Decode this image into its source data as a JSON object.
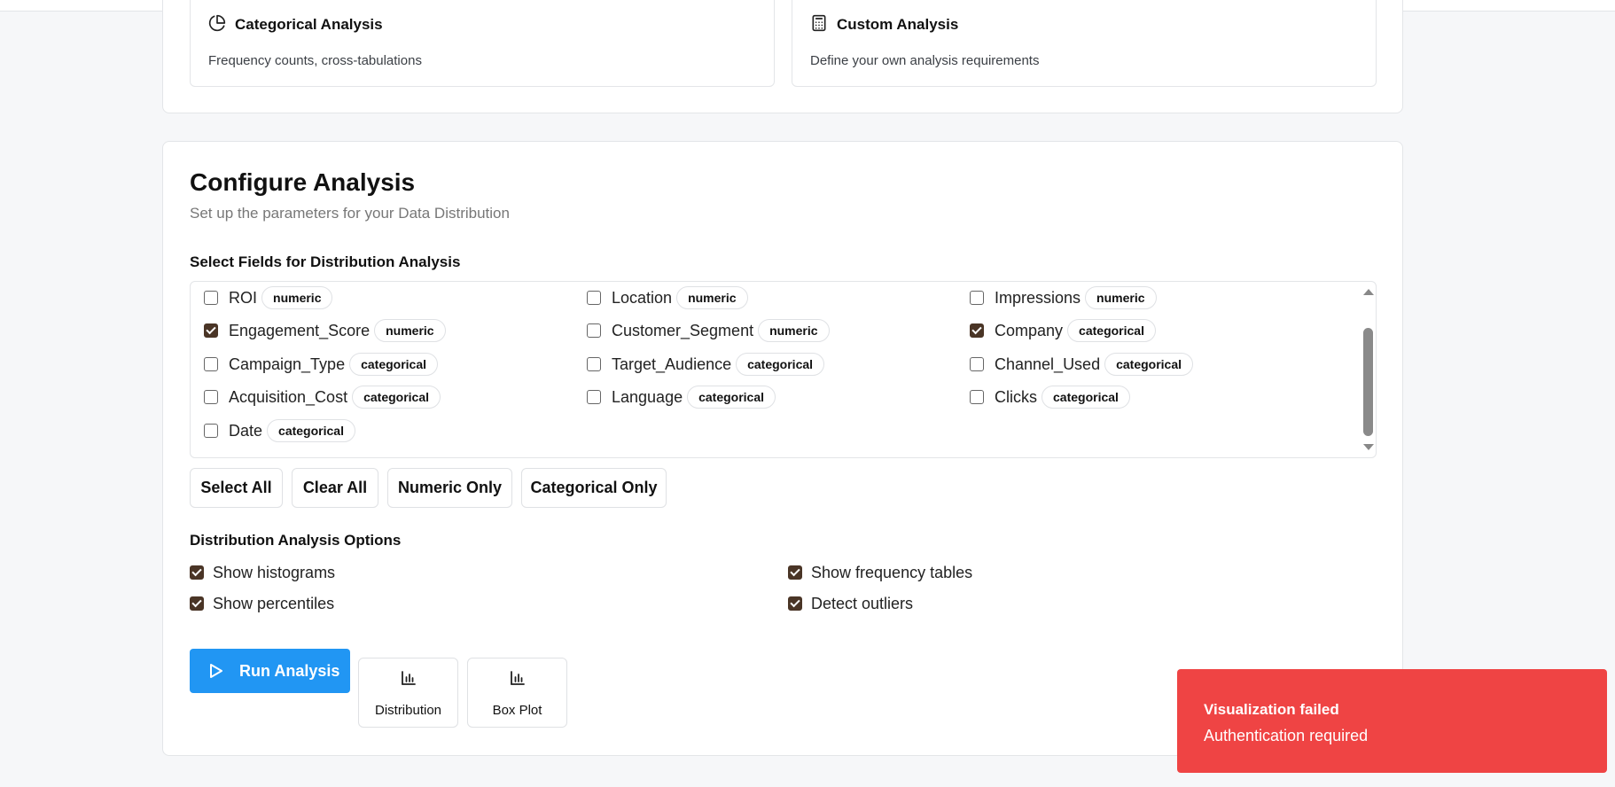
{
  "analysis_types": [
    {
      "title": "Categorical Analysis",
      "description": "Frequency counts, cross-tabulations",
      "icon": "pie-chart-icon"
    },
    {
      "title": "Custom Analysis",
      "description": "Define your own analysis requirements",
      "icon": "calculator-icon"
    }
  ],
  "configure": {
    "title": "Configure Analysis",
    "subtitle": "Set up the parameters for your Data Distribution",
    "fields_label": "Select Fields for Distribution Analysis",
    "fields": [
      {
        "name": "ROI",
        "type": "numeric",
        "checked": false
      },
      {
        "name": "Location",
        "type": "numeric",
        "checked": false
      },
      {
        "name": "Impressions",
        "type": "numeric",
        "checked": false
      },
      {
        "name": "Engagement_Score",
        "type": "numeric",
        "checked": true
      },
      {
        "name": "Customer_Segment",
        "type": "numeric",
        "checked": false
      },
      {
        "name": "Company",
        "type": "categorical",
        "checked": true
      },
      {
        "name": "Campaign_Type",
        "type": "categorical",
        "checked": false
      },
      {
        "name": "Target_Audience",
        "type": "categorical",
        "checked": false
      },
      {
        "name": "Channel_Used",
        "type": "categorical",
        "checked": false
      },
      {
        "name": "Acquisition_Cost",
        "type": "categorical",
        "checked": false
      },
      {
        "name": "Language",
        "type": "categorical",
        "checked": false
      },
      {
        "name": "Clicks",
        "type": "categorical",
        "checked": false
      },
      {
        "name": "Date",
        "type": "categorical",
        "checked": false
      }
    ],
    "buttons": {
      "select_all": "Select All",
      "clear_all": "Clear All",
      "numeric_only": "Numeric Only",
      "categorical_only": "Categorical Only"
    },
    "options_label": "Distribution Analysis Options",
    "options": [
      {
        "label": "Show histograms",
        "checked": true
      },
      {
        "label": "Show frequency tables",
        "checked": true
      },
      {
        "label": "Show percentiles",
        "checked": true
      },
      {
        "label": "Detect outliers",
        "checked": true
      }
    ],
    "run_label": "Run Analysis",
    "viz_buttons": [
      {
        "label": "Distribution",
        "icon": "bar-chart-icon"
      },
      {
        "label": "Box Plot",
        "icon": "bar-chart-icon"
      }
    ]
  },
  "toast": {
    "title": "Visualization failed",
    "message": "Authentication required"
  },
  "colors": {
    "accent": "#2196f3",
    "error": "#ef4444",
    "checkbox": "#4a3526"
  }
}
